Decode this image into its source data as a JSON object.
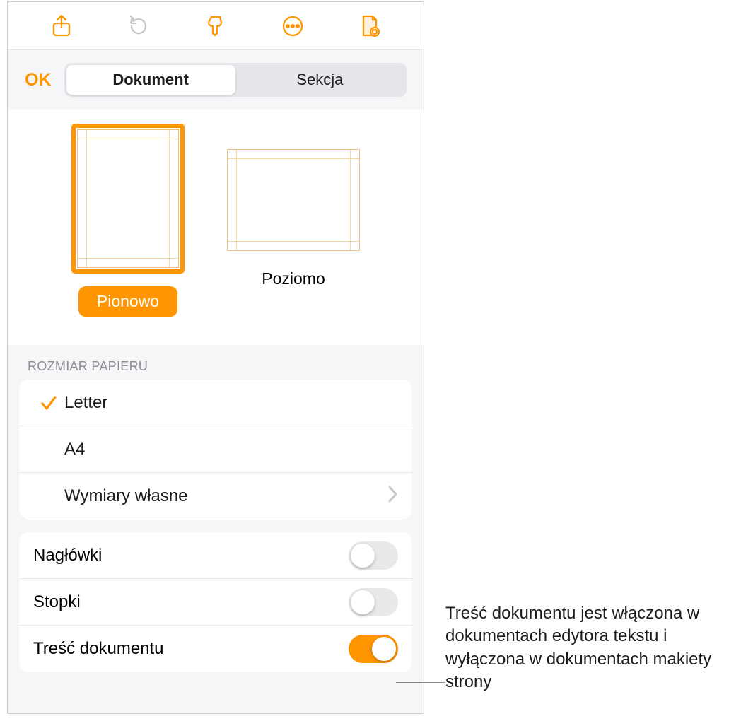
{
  "toolbar": {
    "icons": [
      "share-icon",
      "undo-icon",
      "format-brush-icon",
      "more-icon",
      "document-options-icon"
    ]
  },
  "header": {
    "ok_label": "OK",
    "tabs": {
      "document": "Dokument",
      "section": "Sekcja"
    },
    "active_tab": "document"
  },
  "orientation": {
    "portrait_label": "Pionowo",
    "landscape_label": "Poziomo",
    "selected": "portrait"
  },
  "paper_size": {
    "header": "ROZMIAR PAPIERU",
    "options": {
      "letter": "Letter",
      "a4": "A4",
      "custom": "Wymiary własne"
    },
    "selected": "letter"
  },
  "toggles": {
    "headers": {
      "label": "Nagłówki",
      "on": false
    },
    "footers": {
      "label": "Stopki",
      "on": false
    },
    "document_body": {
      "label": "Treść dokumentu",
      "on": true
    }
  },
  "callout": {
    "text": "Treść dokumentu jest włączona w dokumentach edytora tekstu i wyłączona w dokumentach makiety strony"
  }
}
